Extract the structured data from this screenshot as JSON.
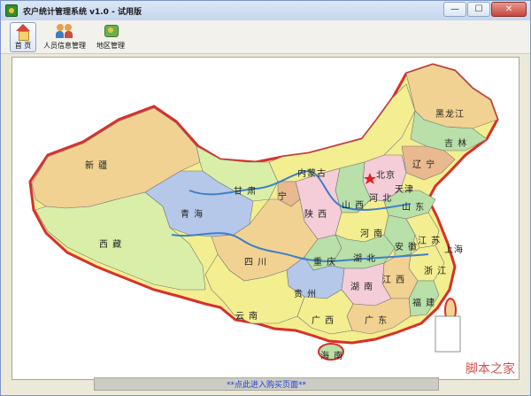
{
  "window": {
    "title": "农户统计管理系统 v1.0 - 试用版",
    "minimize_label": "—",
    "maximize_label": "☐",
    "close_label": "✕"
  },
  "toolbar": {
    "items": [
      {
        "label": "首 页",
        "icon": "home-icon"
      },
      {
        "label": "人员信息管理",
        "icon": "users-icon"
      },
      {
        "label": "地区管理",
        "icon": "region-icon"
      }
    ]
  },
  "map": {
    "provinces": [
      "新 疆",
      "西 藏",
      "青 海",
      "甘 肃",
      "内蒙古",
      "黑龙江",
      "吉 林",
      "辽 宁",
      "北京",
      "天津",
      "河 北",
      "山 西",
      "陕 西",
      "宁",
      "四 川",
      "重 庆",
      "贵 州",
      "云 南",
      "湖 北",
      "湖 南",
      "河 南",
      "山 东",
      "江 苏",
      "安 徽",
      "上海",
      "浙 江",
      "江 西",
      "福 建",
      "广 东",
      "广 西",
      "海 南"
    ],
    "capital_marker": "star-icon"
  },
  "watermark": "脚本之家",
  "purchase_bar": {
    "text": "**点此进入购买页面**"
  },
  "colors": {
    "border_red": "#d8302a",
    "river_blue": "#3f7fc8",
    "link_blue": "#1f3fd6"
  }
}
